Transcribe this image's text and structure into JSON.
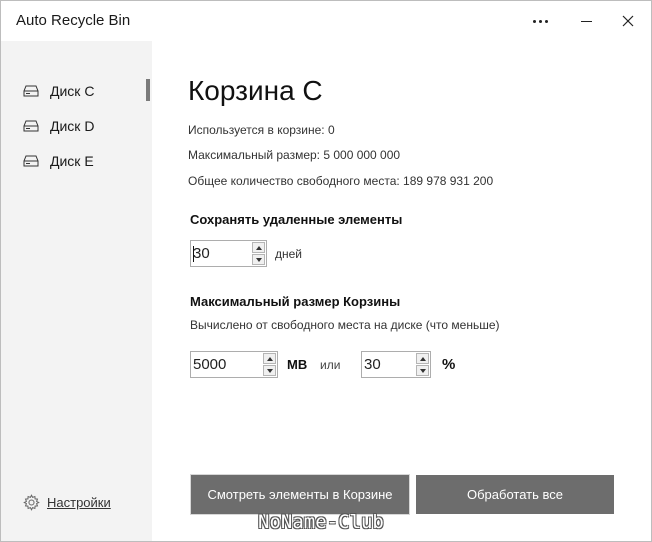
{
  "window": {
    "title": "Auto Recycle Bin",
    "more_icon": "more-horizontal-icon",
    "minimize_icon": "minimize-icon",
    "close_icon": "close-icon",
    "close_glyph": "✕"
  },
  "sidebar": {
    "items": [
      {
        "label": "Диск C",
        "icon": "drive-icon",
        "selected": true
      },
      {
        "label": "Диск D",
        "icon": "drive-icon",
        "selected": false
      },
      {
        "label": "Диск E",
        "icon": "drive-icon",
        "selected": false
      }
    ],
    "settings_label": "Настройки",
    "settings_icon": "gear-icon"
  },
  "main": {
    "title": "Корзина C",
    "used_in_bin": "Используется в корзине: 0",
    "max_size": "Максимальный размер: 5 000 000 000",
    "free_space": "Общее количество свободного места: 189 978 931 200",
    "keep_section": {
      "title": "Сохранять удаленные элементы",
      "days_value": "30",
      "days_unit": "дней"
    },
    "max_section": {
      "title": "Максимальный размер Корзины",
      "description": "Вычислено от свободного места на диске (что меньше)",
      "mb_value": "5000",
      "mb_unit": "МВ",
      "or_label": "или",
      "percent_value": "30",
      "percent_unit": "%"
    },
    "buttons": {
      "view_label": "Смотреть элементы в Корзине",
      "process_label": "Обработать все"
    }
  },
  "watermark": "NoName-Club",
  "colors": {
    "sidebar_bg": "#f3f3f3",
    "button_bg": "#6d6d6d",
    "button_text": "#ffffff",
    "selection_indicator": "#7a7a7a"
  }
}
